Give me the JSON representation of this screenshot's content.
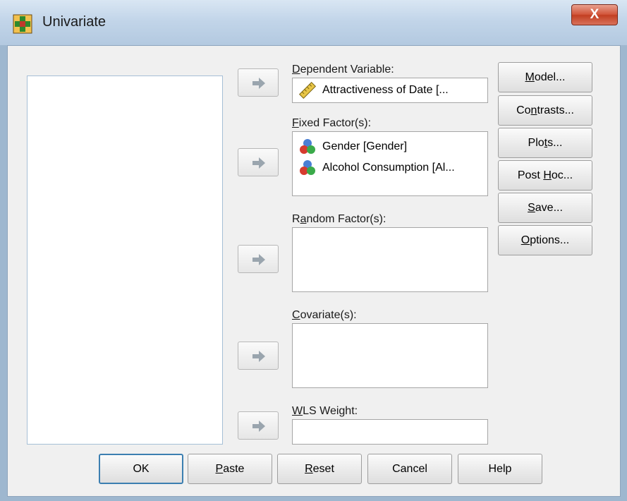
{
  "window": {
    "title": "Univariate",
    "close_glyph": "X"
  },
  "variable_list": {
    "items": []
  },
  "fields": {
    "dependent": {
      "label_u": "D",
      "label_rest": "ependent Variable:",
      "value": "Attractiveness of Date [..."
    },
    "fixed": {
      "label_u": "F",
      "label_rest": "ixed Factor(s):",
      "items": [
        "Gender [Gender]",
        "Alcohol Consumption [Al..."
      ]
    },
    "random": {
      "label_pre": "R",
      "label_u": "a",
      "label_rest": "ndom Factor(s):"
    },
    "covariates": {
      "label_u": "C",
      "label_rest": "ovariate(s):"
    },
    "wls": {
      "label_u": "W",
      "label_rest": "LS Weight:"
    }
  },
  "side_buttons": {
    "model": {
      "u": "M",
      "rest": "odel..."
    },
    "contrasts": {
      "pre": "Co",
      "u": "n",
      "rest": "trasts..."
    },
    "plots": {
      "pre": "Plo",
      "u": "t",
      "rest": "s..."
    },
    "posthoc": {
      "pre": "Post ",
      "u": "H",
      "rest": "oc..."
    },
    "save": {
      "u": "S",
      "rest": "ave..."
    },
    "options": {
      "u": "O",
      "rest": "ptions..."
    }
  },
  "bottom_buttons": {
    "ok": "OK",
    "paste": {
      "u": "P",
      "rest": "aste"
    },
    "reset": {
      "u": "R",
      "rest": "eset"
    },
    "cancel": "Cancel",
    "help": "Help"
  },
  "icons": {
    "app": "plus-table-icon",
    "scale": "ruler-icon",
    "nominal": "three-circles-icon",
    "arrow": "right-arrow-icon"
  },
  "colors": {
    "accent": "#3c7fb1",
    "close": "#c94a2e"
  }
}
